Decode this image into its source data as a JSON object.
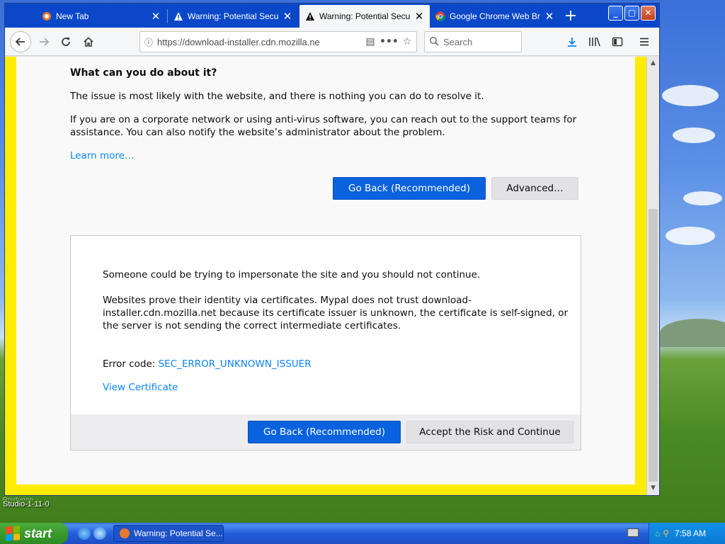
{
  "browser": {
    "tabs": [
      {
        "title": "New Tab",
        "icon": "mypal-icon"
      },
      {
        "title": "Warning: Potential Securit",
        "icon": "warning-icon"
      },
      {
        "title": "Warning: Potential Securit",
        "icon": "warning-icon",
        "active": true
      },
      {
        "title": "Google Chrome Web Brow",
        "icon": "chrome-icon"
      }
    ],
    "url": "https://download-installer.cdn.mozilla.ne",
    "search_placeholder": "Search"
  },
  "page": {
    "heading": "What can you do about it?",
    "para1": "The issue is most likely with the website, and there is nothing you can do to resolve it.",
    "para2_line1": "If you are on a corporate network or using anti-virus software, you can reach out to the support teams for",
    "para2_line2": "assistance. You can also notify the website’s administrator about the problem.",
    "learn_more": "Learn more…",
    "go_back_label": "Go Back (Recommended)",
    "advanced_label": "Advanced…",
    "adv_line1": "Someone could be trying to impersonate the site and you should not continue.",
    "adv_line2": "Websites prove their identity via certificates. Mypal does not trust download-",
    "adv_line3": "installer.cdn.mozilla.net because its certificate issuer is unknown, the certificate is self-signed, or",
    "adv_line4": "the server is not sending the correct intermediate certificates.",
    "error_code_label": "Error code:",
    "error_code": "SEC_ERROR_UNKNOWN_ISSUER",
    "view_certificate": "View Certificate",
    "go_back_label_2": "Go Back (Recommended)",
    "accept_label": "Accept the Risk and Continue"
  },
  "desktop": {
    "icon_label_line1": "Studio-1-11-0",
    "icon_label_partial": "Produgon"
  },
  "taskbar": {
    "start_label": "start",
    "task_label": "Warning: Potential Se...",
    "clock": "7:58 AM"
  },
  "colors": {
    "accent": "#0a62de",
    "link": "#0a84ff",
    "page_border": "#ffec00",
    "tabbar": "#0b48c9"
  }
}
